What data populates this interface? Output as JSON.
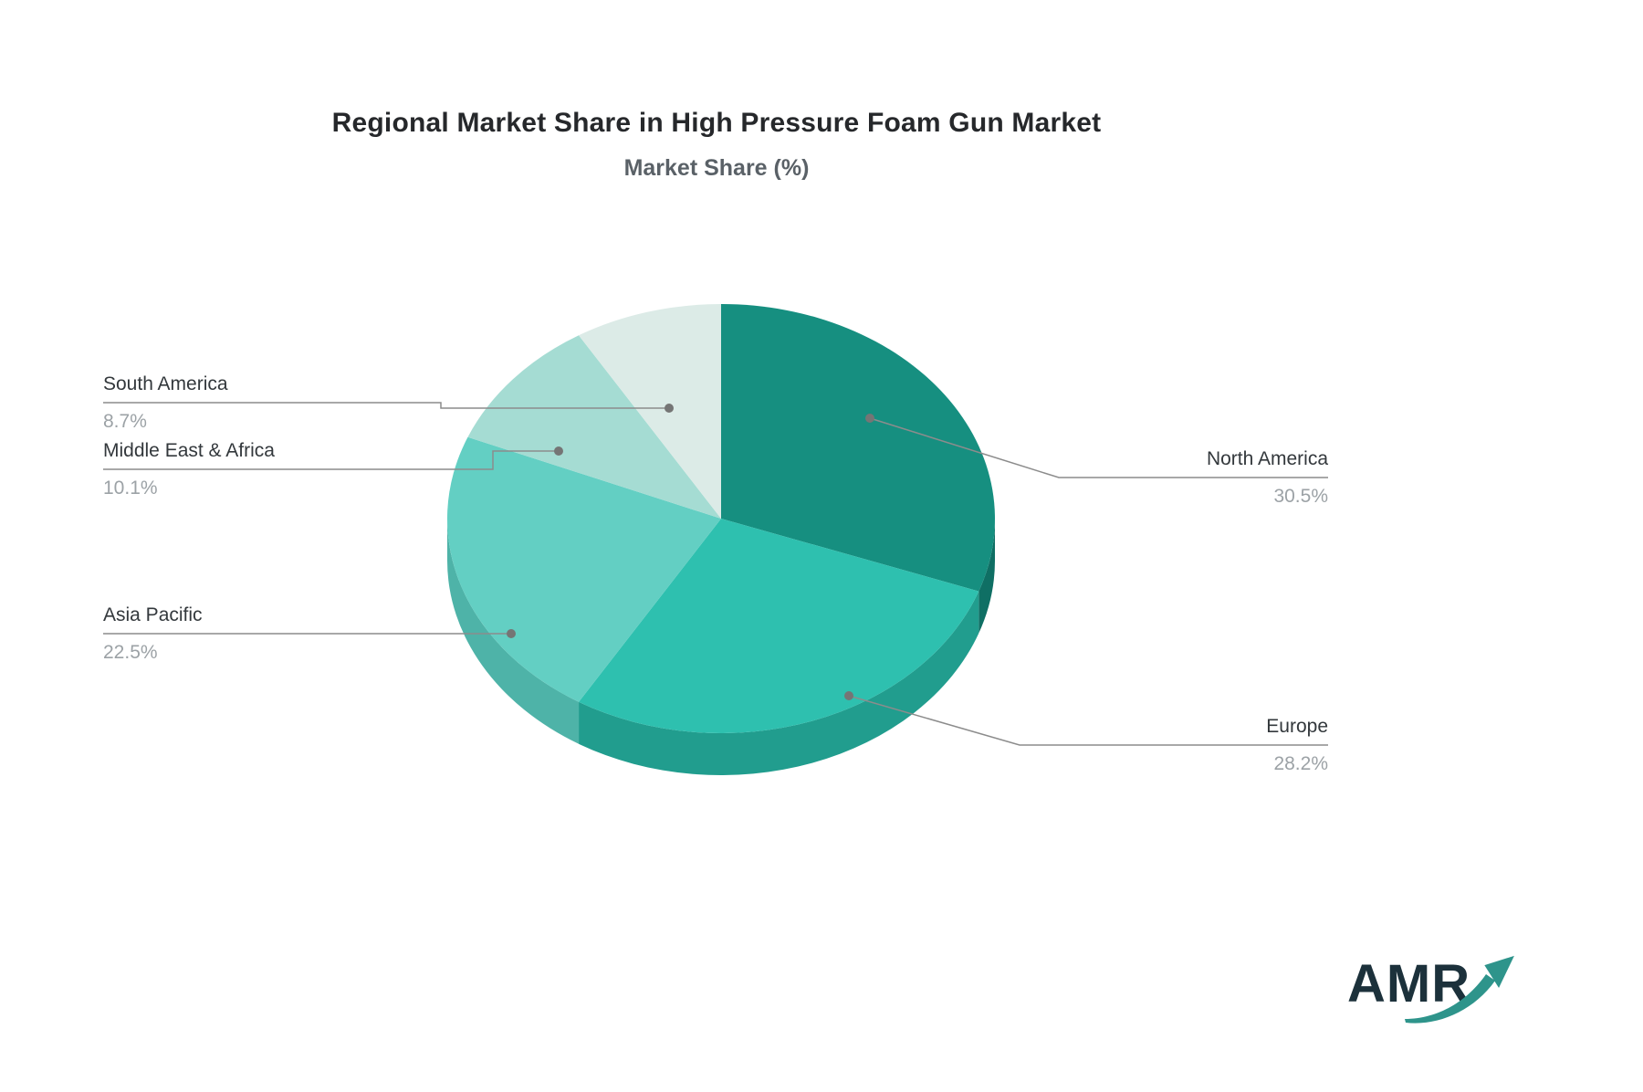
{
  "title": "Regional Market Share in High Pressure Foam Gun Market",
  "subtitle": "Market Share (%)",
  "logo": {
    "text": "AMR"
  },
  "chart_data": {
    "type": "pie",
    "style": "3d",
    "title": "Regional Market Share in High Pressure Foam Gun Market",
    "subtitle": "Market Share (%)",
    "unit": "%",
    "start_angle": "top",
    "direction": "clockwise",
    "categories": [
      "North America",
      "Europe",
      "Asia Pacific",
      "Middle East & Africa",
      "South America"
    ],
    "values": [
      30.5,
      28.2,
      22.5,
      10.1,
      8.7
    ],
    "value_labels": [
      "30.5%",
      "28.2%",
      "22.5%",
      "10.1%",
      "8.7%"
    ],
    "colors": [
      "#168F80",
      "#2EC0AF",
      "#63CFC3",
      "#A5DCD3",
      "#DCEBE7"
    ],
    "side_colors": [
      "#0F6F64",
      "#219D8E",
      "#4EB3A8",
      "#8FC4BB",
      "#C3D6D1"
    ],
    "leader_line_color": "#8c8c8c",
    "leader_dot_color": "#757575",
    "label_name_color": "#33383c",
    "label_value_color": "#9ca2a6",
    "legend_position": "none",
    "grid": false
  }
}
